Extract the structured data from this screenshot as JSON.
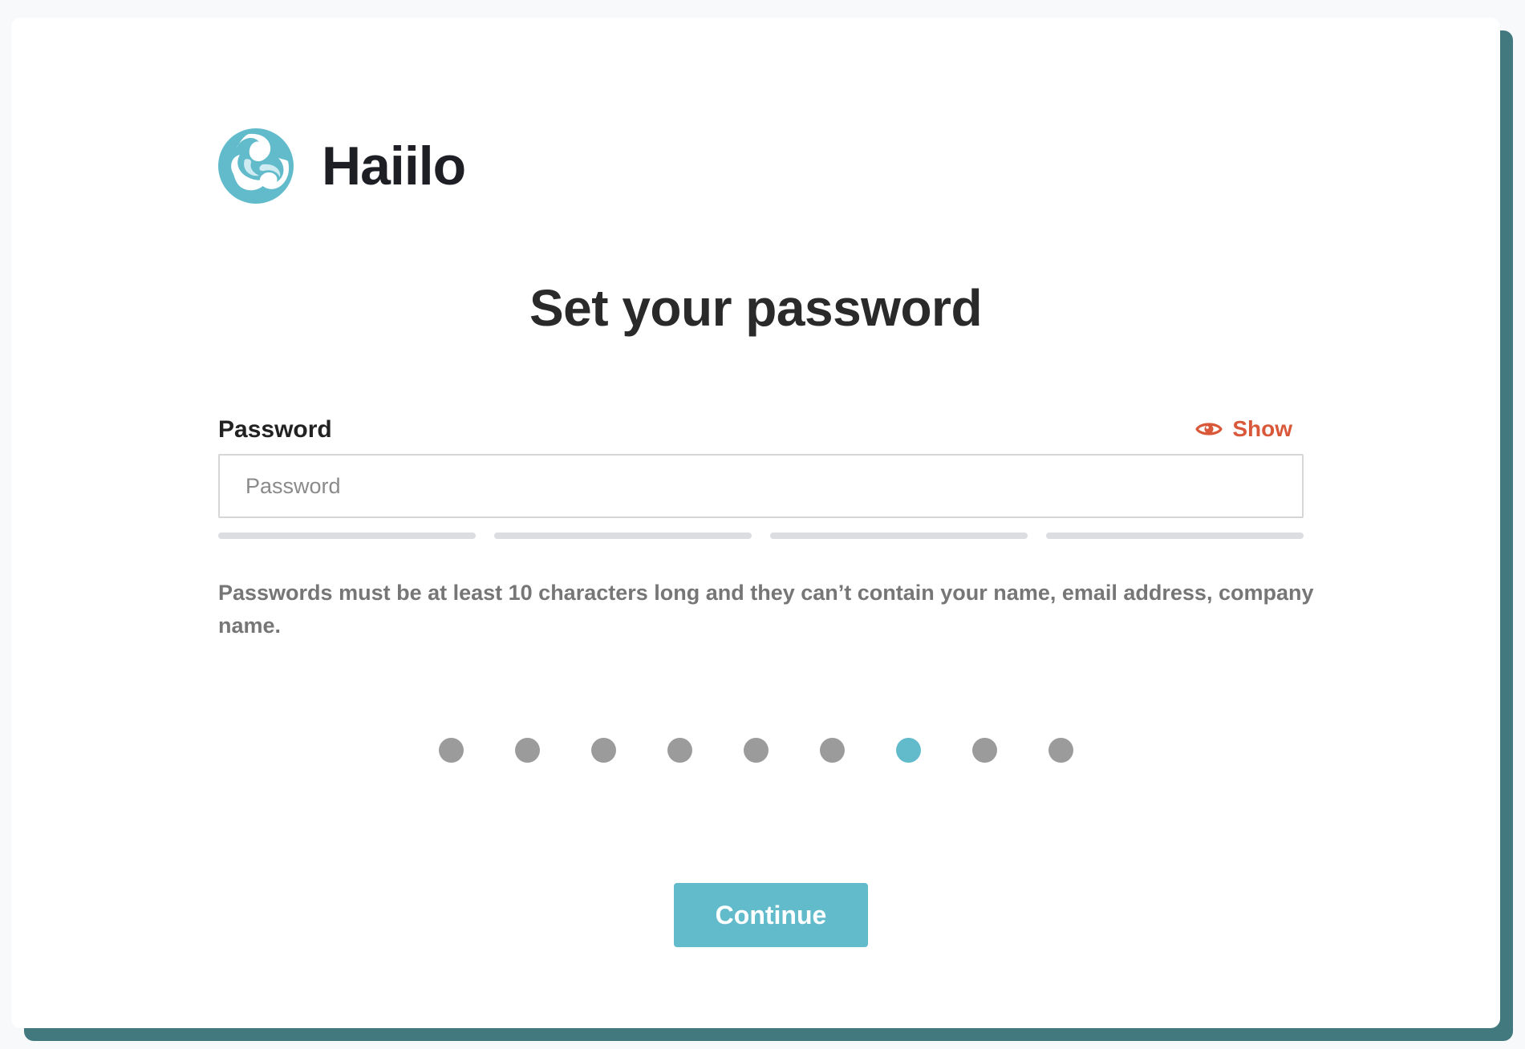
{
  "brand": {
    "name": "Haiilo",
    "logo_icon": "haiilo-logo-icon",
    "accent_color": "#62bbcb",
    "shadow_color": "#41797f"
  },
  "page": {
    "title": "Set your password"
  },
  "password_field": {
    "label": "Password",
    "placeholder": "Password",
    "value": "",
    "show_label": "Show",
    "show_icon": "eye-icon",
    "show_color": "#d9583a",
    "strength_segments": 4,
    "strength_filled": 0
  },
  "hint": "Passwords must be at least 10 characters long and they can’t contain your name, email address, company name.",
  "progress": {
    "total_steps": 9,
    "current_step": 7
  },
  "actions": {
    "continue_label": "Continue"
  }
}
